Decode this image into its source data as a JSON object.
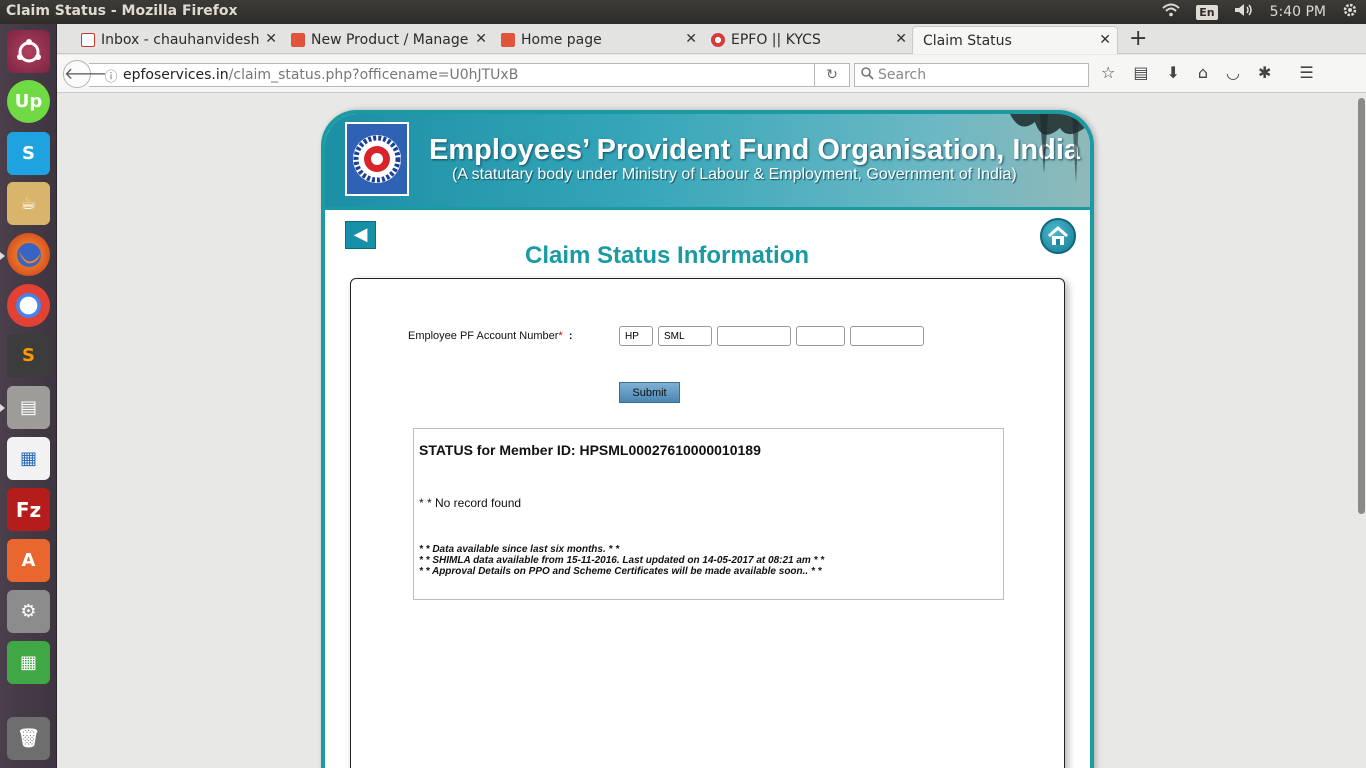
{
  "window": {
    "title": "Claim Status - Mozilla Firefox"
  },
  "tray": {
    "keyboard": "En",
    "time": "5:40 PM"
  },
  "tabs": [
    {
      "label": "Inbox - chauhanvidesh",
      "favicon_color": "#c23b2e"
    },
    {
      "label": "New Product / Manage",
      "favicon_color": "#e0533d"
    },
    {
      "label": "Home page",
      "favicon_color": "#e0533d"
    },
    {
      "label": "EPFO || KYCS",
      "favicon_color": "#d23c3c"
    },
    {
      "label": "Claim Status",
      "favicon_color": ""
    }
  ],
  "url": {
    "domain": "epfoservices.in",
    "path": "/claim_status.php?officename=U0hJTUxB"
  },
  "search": {
    "placeholder": "Search"
  },
  "banner": {
    "title": "Employees’ Provident Fund Organisation, India",
    "subtitle": "(A statutary body under Ministry of Labour & Employment, Government of India)"
  },
  "page_title": "Claim Status Information",
  "form": {
    "pf_label": "Employee PF Account Number",
    "required_mark": "*",
    "colon": ":",
    "fields": [
      "HP",
      "SML",
      "",
      "",
      ""
    ],
    "submit_label": "Submit"
  },
  "status": {
    "title": "STATUS for Member ID: HPSML00027610000010189",
    "message": "* * No record found",
    "notes": [
      "* * Data available since last six months. * *",
      "* * SHIMLA data available from 15-11-2016. Last updated on 14-05-2017 at 08:21 am * *",
      "* * Approval Details on PPO and Scheme Certificates will be made available soon.. * *"
    ]
  },
  "colors": {
    "accent": "#1a9aa3",
    "banner": "#1d8fa5",
    "submit": "#5a92bd"
  }
}
